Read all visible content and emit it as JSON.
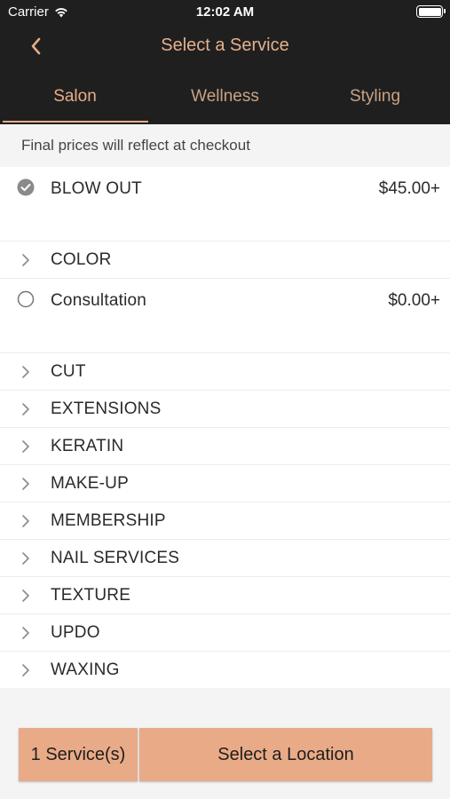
{
  "status_bar": {
    "carrier": "Carrier",
    "time": "12:02 AM"
  },
  "nav": {
    "title": "Select a Service",
    "back_icon": "chevron-left-icon"
  },
  "tabs": [
    {
      "label": "Salon",
      "active": true
    },
    {
      "label": "Wellness",
      "active": false
    },
    {
      "label": "Styling",
      "active": false
    }
  ],
  "notice": "Final prices will reflect at checkout",
  "services": [
    {
      "label": "BLOW OUT",
      "price": "$45.00+",
      "type": "item",
      "selected": true
    },
    {
      "label": "COLOR",
      "type": "category"
    },
    {
      "label": "Consultation",
      "price": "$0.00+",
      "type": "item",
      "selected": false
    },
    {
      "label": "CUT",
      "type": "category"
    },
    {
      "label": "EXTENSIONS",
      "type": "category"
    },
    {
      "label": "KERATIN",
      "type": "category"
    },
    {
      "label": "MAKE-UP",
      "type": "category"
    },
    {
      "label": "MEMBERSHIP",
      "type": "category"
    },
    {
      "label": "NAIL SERVICES",
      "type": "category"
    },
    {
      "label": "TEXTURE",
      "type": "category"
    },
    {
      "label": "UPDO",
      "type": "category"
    },
    {
      "label": "WAXING",
      "type": "category"
    }
  ],
  "bottom": {
    "count_label": "1 Service(s)",
    "location_label": "Select a Location"
  },
  "colors": {
    "header_bg": "#1f1f1f",
    "accent": "#e6ad88",
    "button_bg": "#e9ab87"
  }
}
